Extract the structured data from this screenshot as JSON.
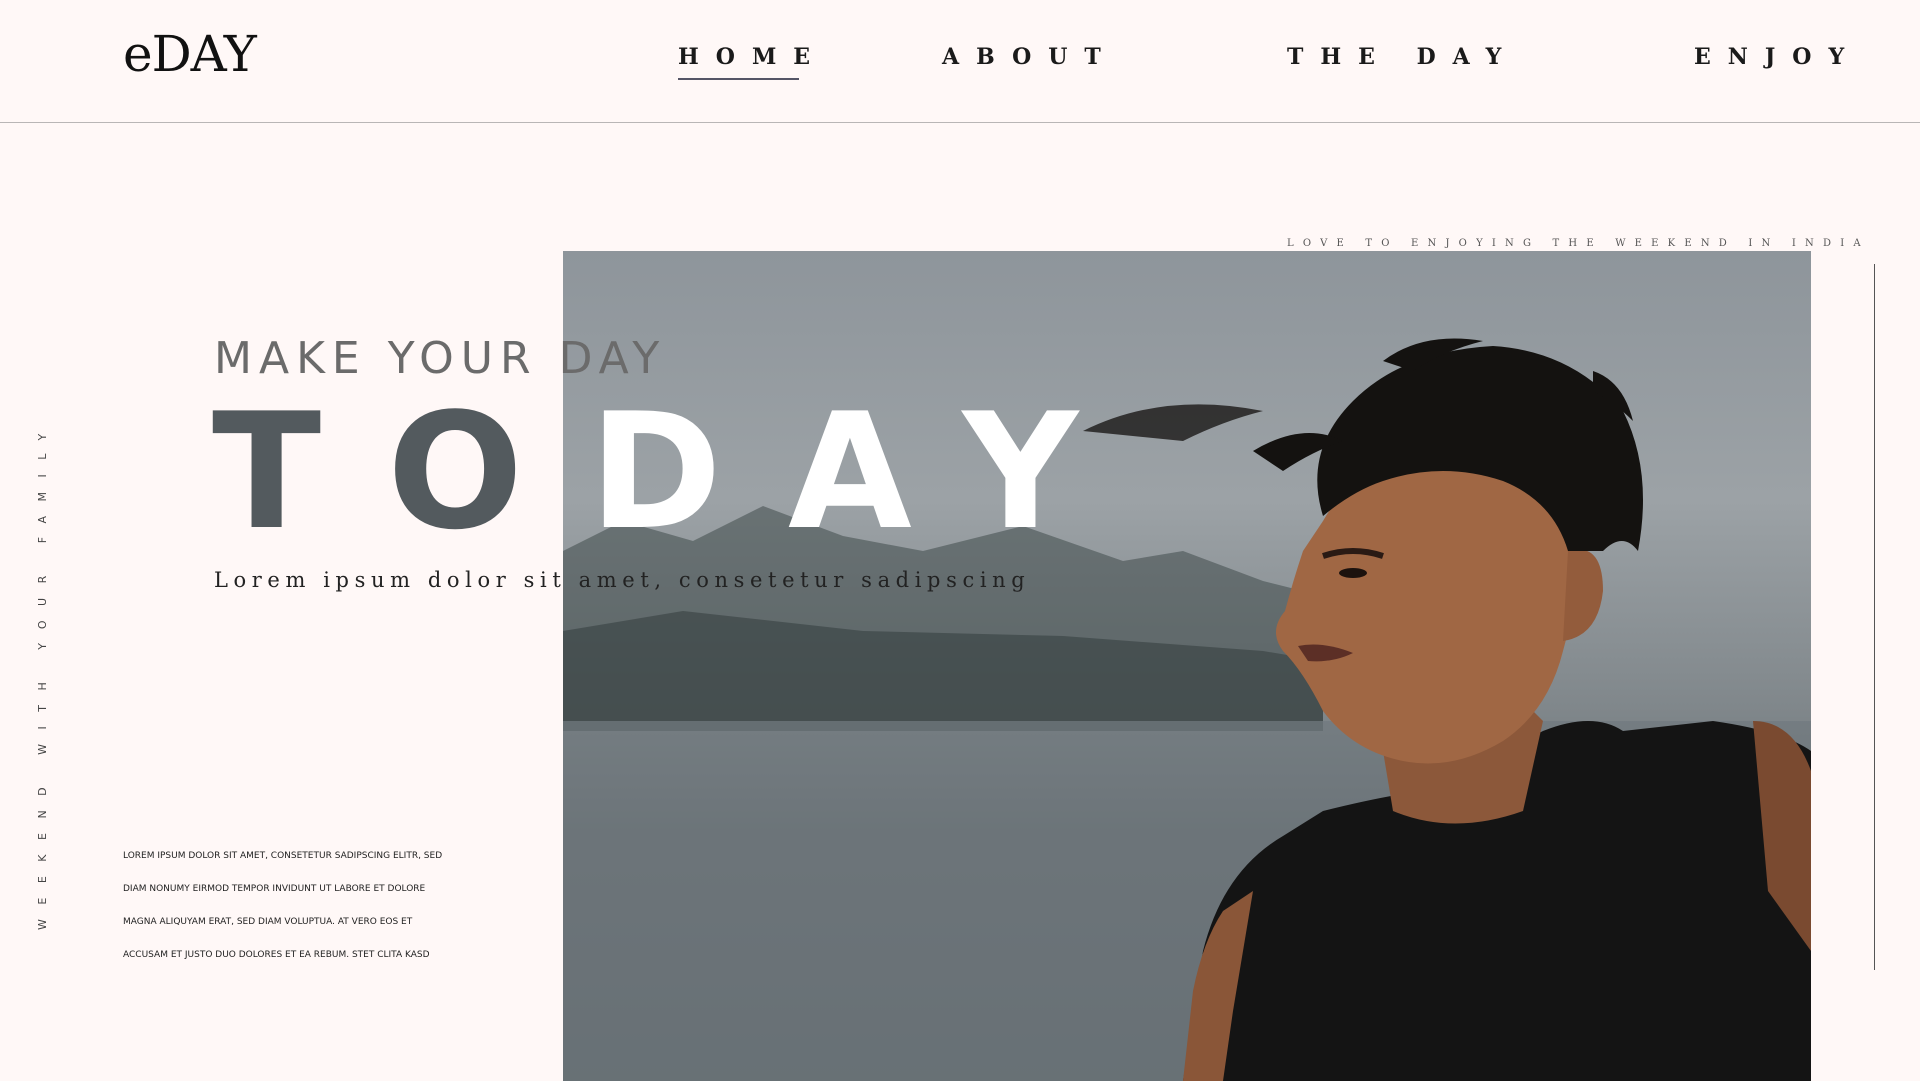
{
  "header": {
    "logo": "eDAY",
    "nav": {
      "home": "HOME",
      "about": "ABOUT",
      "the_day": "THE DAY",
      "enjoy": "ENJOY"
    },
    "active_nav": "HOME"
  },
  "hero": {
    "tagline_top": "LOVE TO ENJOYING THE WEEKEND IN INDIA",
    "vertical_text": "WEEKEND WITH YOUR FAMILY",
    "sub_title": "MAKE YOUR DAY",
    "title_part1": "TO",
    "title_part2": "DAY",
    "lead": "Lorem ipsum dolor sit amet, consetetur sadipscing",
    "body": "LOREM IPSUM DOLOR SIT AMET, CONSETETUR SADIPSCING ELITR, SED DIAM NONUMY EIRMOD TEMPOR INVIDUNT UT LABORE ET DOLORE MAGNA ALIQUYAM ERAT, SED DIAM VOLUPTUA. AT VERO EOS ET ACCUSAM ET JUSTO DUO DOLORES ET EA REBUM. STET CLITA KASD"
  },
  "colors": {
    "background": "#fff8f7",
    "title_dark": "#535a5e",
    "title_light": "#ffffff"
  }
}
